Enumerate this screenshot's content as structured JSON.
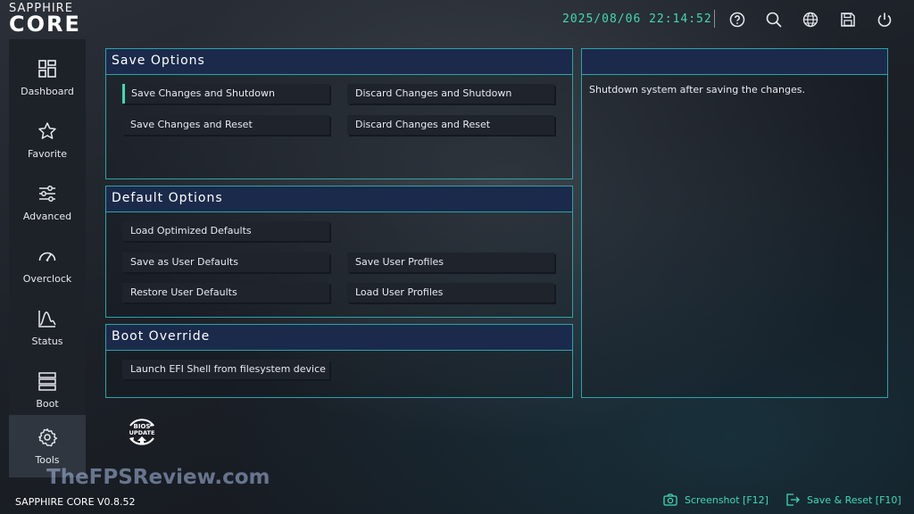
{
  "brand": {
    "line1": "SAPPHIRE",
    "line2": "CORE"
  },
  "header": {
    "datetime": "2025/08/06 22:14:52",
    "icons": [
      "help-icon",
      "search-icon",
      "language-globe-icon",
      "save-disk-icon",
      "power-icon"
    ]
  },
  "sidebar": {
    "items": [
      {
        "label": "Dashboard",
        "icon": "dashboard-icon"
      },
      {
        "label": "Favorite",
        "icon": "star-icon"
      },
      {
        "label": "Advanced",
        "icon": "sliders-icon"
      },
      {
        "label": "Overclock",
        "icon": "gauge-icon"
      },
      {
        "label": "Status",
        "icon": "chart-icon"
      },
      {
        "label": "Boot",
        "icon": "boot-stack-icon"
      },
      {
        "label": "Tools",
        "icon": "gear-icon",
        "active": true
      }
    ]
  },
  "save_options": {
    "title": "Save Options",
    "buttons": [
      "Save Changes and Shutdown",
      "Discard Changes and Shutdown",
      "Save Changes and Reset",
      "Discard Changes and Reset"
    ],
    "selected": "Save Changes and Shutdown"
  },
  "default_options": {
    "title": "Default Options",
    "buttons": [
      "Load Optimized Defaults",
      "Save as User Defaults",
      "Save User Profiles",
      "Restore User Defaults",
      "Load User Profiles"
    ]
  },
  "boot_override": {
    "title": "Boot Override",
    "buttons": [
      "Launch EFI Shell from filesystem device"
    ]
  },
  "description": {
    "text": "Shutdown system after saving the changes."
  },
  "bios_update": {
    "label_top": "BIOS",
    "label_bottom": "UPDATE"
  },
  "footer": {
    "version": "SAPPHIRE CORE V0.8.52",
    "screenshot": "Screenshot [F12]",
    "save_reset": "Save & Reset [F10]"
  },
  "watermark": "TheFPSReview.com",
  "colors": {
    "accent": "#3fd9b1",
    "panel_border": "#2aa3a8",
    "panel_head": "#1b2a4a"
  }
}
